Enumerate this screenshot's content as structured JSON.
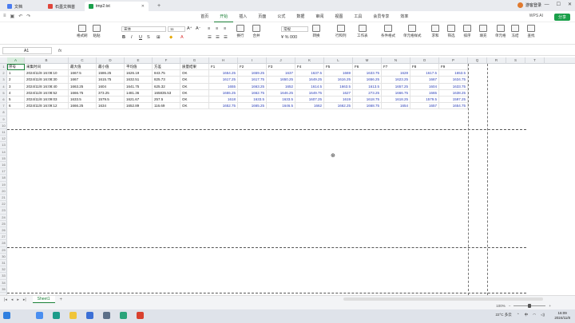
{
  "tabs": [
    {
      "label": "文档"
    },
    {
      "label": "石墨文档首"
    },
    {
      "label": "tmp2.txt"
    }
  ],
  "top_right": {
    "username": "游客登录"
  },
  "menu": {
    "items": [
      "首页",
      "开始",
      "插入",
      "页面",
      "公式",
      "数据",
      "审阅",
      "视图",
      "工具",
      "会员专享",
      "效率"
    ],
    "active_index": 1,
    "right": [
      "WPS AI",
      "分享"
    ],
    "share_label": "分享"
  },
  "ribbon": {
    "format_painter": "格式刷",
    "paste": "粘贴",
    "font_name": "宋体",
    "font_size": "11",
    "wrap": "换行",
    "merge": "合并",
    "general": "常规",
    "convert": "转换",
    "rows_cols": "行和列",
    "worksheet": "工作表",
    "conditional": "条件格式",
    "cell_style": "单元格样式",
    "sum": "求和",
    "filter": "筛选",
    "sort": "排序",
    "fill": "填充",
    "cell": "单元格",
    "freeze": "冻结",
    "find": "查找"
  },
  "formula": {
    "cell_ref": "A1",
    "fx": "fx",
    "value": ""
  },
  "columns": [
    "A",
    "B",
    "C",
    "D",
    "E",
    "F",
    "G",
    "H",
    "I",
    "J",
    "K",
    "L",
    "M",
    "N",
    "O",
    "P",
    "Q",
    "R",
    "S",
    "T"
  ],
  "header_row": [
    "序号",
    "采集时间",
    "最大值",
    "最小值",
    "平均值",
    "方差",
    "质量结果",
    "F1",
    "F2",
    "F3",
    "F4",
    "F5",
    "F6",
    "F7",
    "F8",
    "F9"
  ],
  "data_rows": [
    [
      "1",
      "2024/11/8 16:08:10",
      "1667.5",
      "1586.25",
      "1626.19",
      "843.75",
      "OK",
      "1654.25",
      "1659.25",
      "1637",
      "1637.5",
      "1669",
      "1633.75",
      "1628",
      "1617.5",
      "1653.5"
    ],
    [
      "2",
      "2024/11/8 16:08:30",
      "1667",
      "1615.75",
      "1632.51",
      "825.73",
      "OK",
      "1617.25",
      "1617.75",
      "1650.25",
      "1649.25",
      "1616.25",
      "1656.25",
      "1623.25",
      "1667",
      "1634.75"
    ],
    [
      "3",
      "2024/11/8 16:08:40",
      "1663.25",
      "1604",
      "1641.75",
      "625.32",
      "OK",
      "1655",
      "1663.25",
      "1652",
      "1614.5",
      "1663.5",
      "1613.5",
      "1657.25",
      "1604",
      "1633.75"
    ],
    [
      "4",
      "2024/11/8 16:08:52",
      "1666.75",
      "373.25",
      "1481.36",
      "165835.53",
      "OK",
      "1655.25",
      "1662.75",
      "1646.25",
      "1649.75",
      "1627",
      "273.25",
      "1666.75",
      "1665",
      "1638.25"
    ],
    [
      "5",
      "2024/11/8 16:09:03",
      "1633.5",
      "1579.5",
      "1621.67",
      "257.5",
      "OK",
      "1618",
      "1633.5",
      "1633.5",
      "1607.25",
      "1619",
      "1618.75",
      "1618.25",
      "1579.5",
      "1597.25"
    ],
    [
      "6",
      "2024/11/8 16:09:12",
      "1666.25",
      "1634",
      "1652.89",
      "116.69",
      "OK",
      "1652.75",
      "1665.25",
      "1646.5",
      "1662",
      "1662.25",
      "1668.75",
      "1654",
      "1657",
      "1654.75"
    ]
  ],
  "row_numbers": [
    "1",
    "2",
    "3",
    "4",
    "5",
    "6",
    "7",
    "8",
    "9",
    "10",
    "11",
    "12",
    "13",
    "14",
    "15",
    "16",
    "17",
    "18",
    "19",
    "20",
    "21",
    "22",
    "23",
    "24",
    "25",
    "26",
    "27",
    "28",
    "29",
    "30",
    "31",
    "32",
    "33",
    "34",
    "35"
  ],
  "sheet": {
    "name": "Sheet1"
  },
  "zoom": "100%",
  "taskbar": {
    "weather": "22°C 多云",
    "time": "16:09",
    "date": "2024/11/8",
    "lang": "中",
    "search": "搜索"
  }
}
